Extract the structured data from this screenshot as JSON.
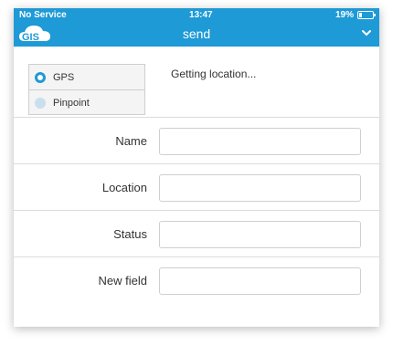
{
  "status_bar": {
    "carrier": "No Service",
    "time": "13:47",
    "battery_percent": "19%",
    "battery_level": 0.19
  },
  "nav": {
    "logo_text": "GIS",
    "title": "send",
    "menu_icon": "chevron-down-icon"
  },
  "location": {
    "options": [
      {
        "label": "GPS",
        "selected": true
      },
      {
        "label": "Pinpoint",
        "selected": false
      }
    ],
    "status_text": "Getting location..."
  },
  "fields": [
    {
      "label": "Name",
      "value": ""
    },
    {
      "label": "Location",
      "value": ""
    },
    {
      "label": "Status",
      "value": ""
    },
    {
      "label": "New field",
      "value": ""
    }
  ],
  "colors": {
    "accent": "#1e9ad6",
    "radio_off": "#c9dfee",
    "border": "#cfcfcf"
  }
}
